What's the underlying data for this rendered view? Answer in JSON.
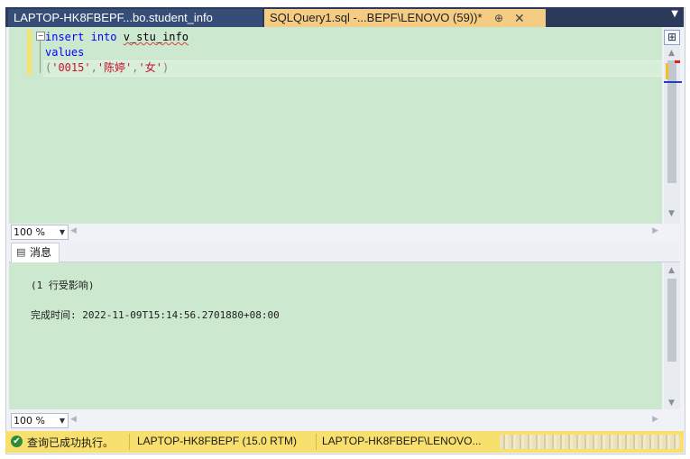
{
  "tabs": {
    "inactive_label": "LAPTOP-HK8FBEPF...bo.student_info",
    "active_label": "SQLQuery1.sql -...BEPF\\LENOVO (59))*",
    "pin_glyph": "⊕",
    "close_glyph": "✕",
    "overflow_glyph": "▼"
  },
  "editor": {
    "line1_kw1": "insert",
    "line1_kw2": "into",
    "line1_ident": "v_stu_info",
    "line2_kw": "values",
    "line3_open": "(",
    "line3_s1": "'0015'",
    "line3_c1": ",",
    "line3_s2": "'陈婷'",
    "line3_c2": ",",
    "line3_s3": "'女'",
    "line3_close": ")"
  },
  "zoom": {
    "editor_value": "100 %",
    "results_value": "100 %"
  },
  "results_tab": {
    "label": "消息"
  },
  "messages": {
    "line1": "(1 行受影响)",
    "line2": "完成时间: 2022-11-09T15:14:56.2701880+08:00"
  },
  "statusbar": {
    "status_text": "查询已成功执行。",
    "server_text": "LAPTOP-HK8FBEPF (15.0 RTM)",
    "login_text": "LAPTOP-HK8FBEPF\\LENOVO..."
  },
  "colors": {
    "editor_background": "#cce8cf",
    "active_tab": "#f5cc84",
    "tab_strip": "#2b3a5a",
    "status_bar": "#f7e06e",
    "keyword": "#0000ff",
    "string": "#c8102e"
  }
}
